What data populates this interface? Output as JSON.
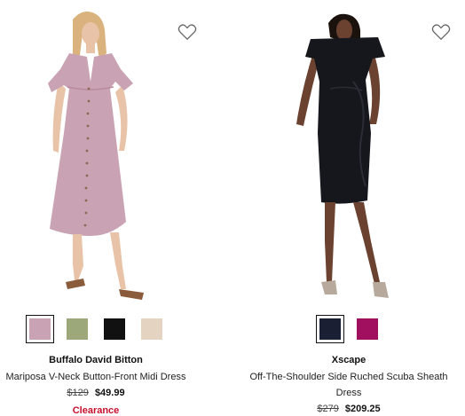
{
  "products": [
    {
      "brand": "Buffalo David Bitton",
      "name": "Mariposa V-Neck Button-Front Midi Dress",
      "original_price": "$129",
      "sale_price": "$49.99",
      "badge": "Clearance",
      "wishlist_icon": "heart-outline-icon",
      "swatches": [
        {
          "color": "#c9a2b3",
          "selected": true
        },
        {
          "color": "#9ca77a",
          "selected": false
        },
        {
          "color": "#111111",
          "selected": false
        },
        {
          "color": "#e3d3c0",
          "selected": false
        }
      ],
      "image_colors": {
        "dress": "#c9a2b3",
        "skin": "#e9c3a7",
        "hair": "#d9b27e",
        "sandal": "#8a5c3b"
      }
    },
    {
      "brand": "Xscape",
      "name": "Off-The-Shoulder Side Ruched Scuba Sheath Dress",
      "original_price": "$279",
      "sale_price": "$209.25",
      "wishlist_icon": "heart-outline-icon",
      "swatches": [
        {
          "color": "#1a1f33",
          "selected": true
        },
        {
          "color": "#a0105f",
          "selected": false
        }
      ],
      "image_colors": {
        "dress": "#15171c",
        "skin": "#6b4230",
        "hair": "#1c120d",
        "heel": "#b7a99c"
      }
    }
  ]
}
